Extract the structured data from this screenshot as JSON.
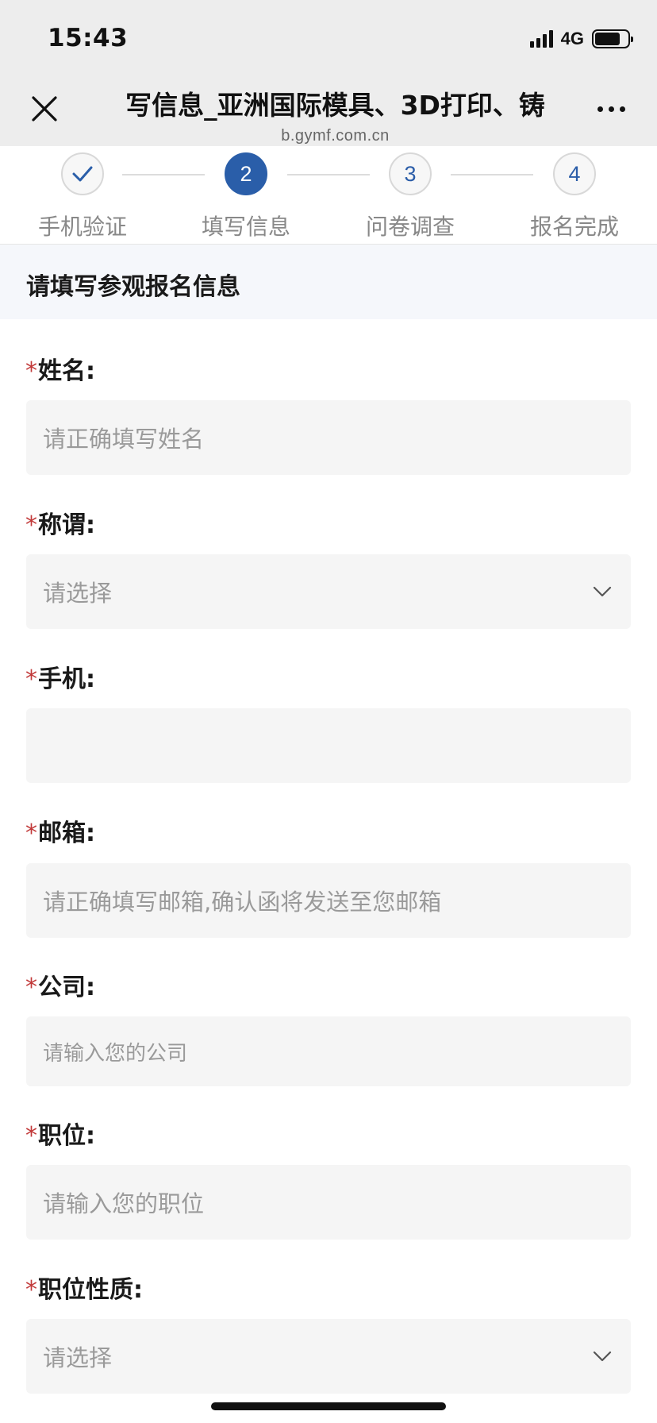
{
  "status_bar": {
    "time": "15:43",
    "network": "4G"
  },
  "nav": {
    "title": "写信息_亚洲国际模具、3D打印、铸",
    "url": "b.gymf.com.cn",
    "close_icon": "close-icon",
    "more_icon": "more-icon"
  },
  "stepper": {
    "steps": [
      {
        "number": "✓",
        "label": "手机验证",
        "state": "done"
      },
      {
        "number": "2",
        "label": "填写信息",
        "state": "active"
      },
      {
        "number": "3",
        "label": "问卷调查",
        "state": "pending"
      },
      {
        "number": "4",
        "label": "报名完成",
        "state": "pending"
      }
    ],
    "active_color": "#2a5ea9"
  },
  "section": {
    "title": "请填写参观报名信息"
  },
  "form": {
    "required_mark": "*",
    "fields": [
      {
        "label": "姓名:",
        "type": "text",
        "placeholder": "请正确填写姓名",
        "value": ""
      },
      {
        "label": "称谓:",
        "type": "select",
        "placeholder": "请选择",
        "value": ""
      },
      {
        "label": "手机:",
        "type": "text",
        "placeholder": "",
        "value": ""
      },
      {
        "label": "邮箱:",
        "type": "text",
        "placeholder": "请正确填写邮箱,确认函将发送至您邮箱",
        "value": ""
      },
      {
        "label": "公司:",
        "type": "text",
        "placeholder": "请输入您的公司",
        "value": ""
      },
      {
        "label": "职位:",
        "type": "text",
        "placeholder": "请输入您的职位",
        "value": ""
      },
      {
        "label": "职位性质:",
        "type": "select",
        "placeholder": "请选择",
        "value": ""
      }
    ]
  },
  "colors": {
    "required": "#c23a3a",
    "input_bg": "#f5f5f5",
    "header_bg": "#ededed"
  }
}
